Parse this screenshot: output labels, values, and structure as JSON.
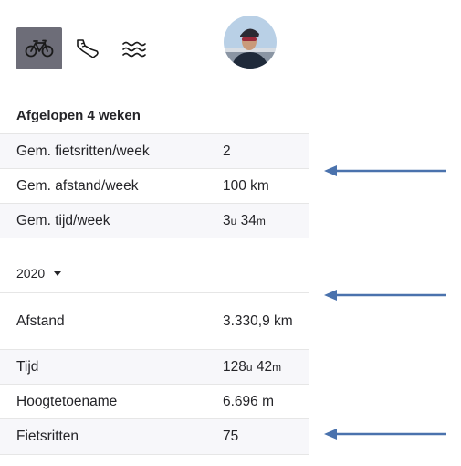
{
  "sports": [
    {
      "icon": "bike-icon",
      "selected": true
    },
    {
      "icon": "shoe-icon",
      "selected": false
    },
    {
      "icon": "waves-icon",
      "selected": false
    }
  ],
  "recent": {
    "title": "Afgelopen 4 weken",
    "rows": [
      {
        "label": "Gem. fietsritten/week",
        "value": "2"
      },
      {
        "label": "Gem. afstand/week",
        "value": "100 km"
      },
      {
        "label": "Gem. tijd/week",
        "hours": "3",
        "hours_unit": "u",
        "minutes": "34",
        "minutes_unit": "m"
      }
    ]
  },
  "year": {
    "selected": "2020",
    "rows": [
      {
        "label": "Afstand",
        "value": "3.330,9 km"
      },
      {
        "label": "Tijd",
        "hours": "128",
        "hours_unit": "u",
        "minutes": "42",
        "minutes_unit": "m"
      },
      {
        "label": "Hoogtetoename",
        "value": "6.696 m"
      },
      {
        "label": "Fietsritten",
        "value": "75"
      }
    ]
  },
  "colors": {
    "selected_tab": "#6d6d78",
    "row_alt": "#f7f7fa",
    "arrow": "#4a72ad"
  }
}
